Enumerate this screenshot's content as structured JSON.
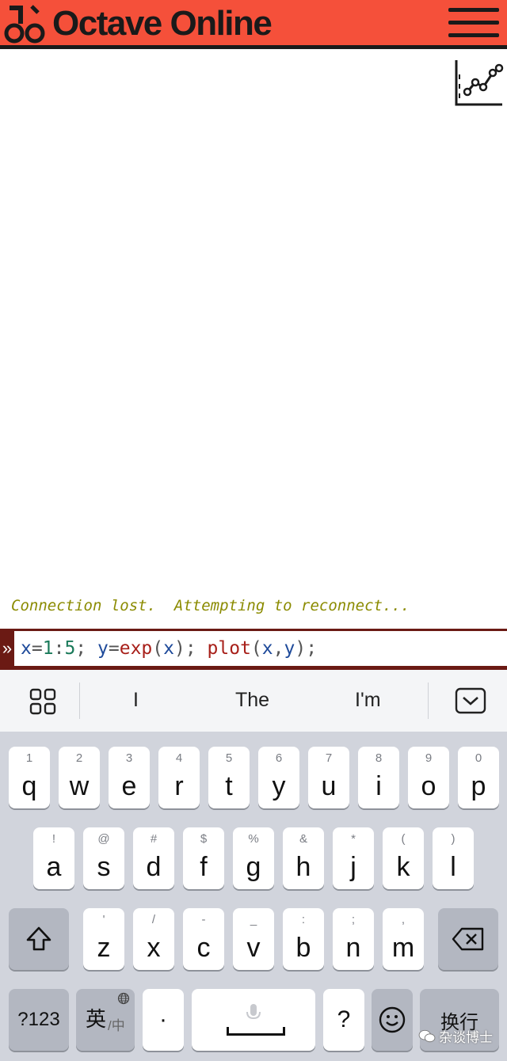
{
  "header": {
    "brand": "Octave Online",
    "logo_icon": "octave-logo-icon",
    "menu_icon": "hamburger-menu-icon",
    "background_color": "#f5503a"
  },
  "toolbar": {
    "plot_icon": "plot-chart-icon"
  },
  "console": {
    "message": "Connection lost.  Attempting to reconnect...",
    "prompt_marker": "»",
    "command_parts": {
      "p1": "x",
      "p2": "=",
      "p3": "1",
      "p4": ":",
      "p5": "5",
      "p6": "; ",
      "p7": "y",
      "p8": "=",
      "p9": "exp",
      "p10": "(",
      "p11": "x",
      "p12": "); ",
      "p13": "plot",
      "p14": "(",
      "p15": "x",
      "p16": ",",
      "p17": "y",
      "p18": ");"
    }
  },
  "keyboard": {
    "suggestions": [
      "I",
      "The",
      "I'm"
    ],
    "grid_icon": "keyboard-grid-icon",
    "hide_icon": "keyboard-hide-icon",
    "row1": [
      {
        "hint": "1",
        "key": "q"
      },
      {
        "hint": "2",
        "key": "w"
      },
      {
        "hint": "3",
        "key": "e"
      },
      {
        "hint": "4",
        "key": "r"
      },
      {
        "hint": "5",
        "key": "t"
      },
      {
        "hint": "6",
        "key": "y"
      },
      {
        "hint": "7",
        "key": "u"
      },
      {
        "hint": "8",
        "key": "i"
      },
      {
        "hint": "9",
        "key": "o"
      },
      {
        "hint": "0",
        "key": "p"
      }
    ],
    "row2": [
      {
        "hint": "!",
        "key": "a"
      },
      {
        "hint": "@",
        "key": "s"
      },
      {
        "hint": "#",
        "key": "d"
      },
      {
        "hint": "$",
        "key": "f"
      },
      {
        "hint": "%",
        "key": "g"
      },
      {
        "hint": "&",
        "key": "h"
      },
      {
        "hint": "*",
        "key": "j"
      },
      {
        "hint": "(",
        "key": "k"
      },
      {
        "hint": ")",
        "key": "l"
      }
    ],
    "row3": [
      {
        "hint": "'",
        "key": "z"
      },
      {
        "hint": "/",
        "key": "x"
      },
      {
        "hint": "-",
        "key": "c"
      },
      {
        "hint": "_",
        "key": "v"
      },
      {
        "hint": ":",
        "key": "b"
      },
      {
        "hint": ";",
        "key": "n"
      },
      {
        "hint": ",",
        "key": "m"
      }
    ],
    "shift_icon": "shift-arrow-icon",
    "backspace_icon": "backspace-icon",
    "num_label": "?123",
    "lang_label": "英",
    "lang_sub": "/中",
    "globe_icon": "globe-icon",
    "dot_label": "·",
    "mic_icon": "microphone-icon",
    "question_label": "?",
    "emoji_icon": "emoji-icon",
    "return_label": "换行"
  },
  "watermark": {
    "text": "杂谈博士",
    "icon": "wechat-icon"
  }
}
